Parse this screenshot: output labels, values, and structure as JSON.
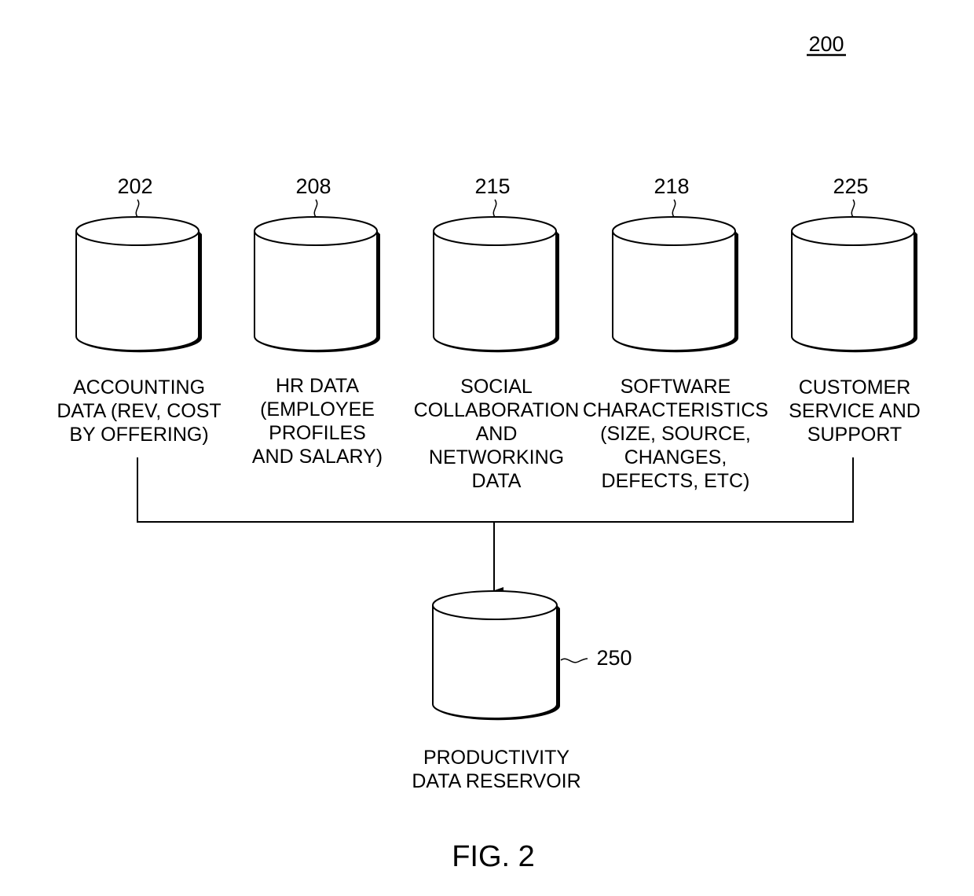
{
  "figure": {
    "number_label": "200",
    "caption": "FIG. 2"
  },
  "sources": [
    {
      "ref": "202",
      "lines": [
        "ACCOUNTING",
        "DATA (REV, COST",
        "BY OFFERING)"
      ]
    },
    {
      "ref": "208",
      "lines": [
        "HR DATA",
        "(EMPLOYEE",
        "PROFILES",
        "AND SALARY)"
      ]
    },
    {
      "ref": "215",
      "lines": [
        "SOCIAL",
        "COLLABORATION",
        "AND",
        "NETWORKING",
        "DATA"
      ]
    },
    {
      "ref": "218",
      "lines": [
        "SOFTWARE",
        "CHARACTERISTICS",
        "(SIZE, SOURCE,",
        "CHANGES,",
        "DEFECTS, ETC)"
      ]
    },
    {
      "ref": "225",
      "lines": [
        "CUSTOMER",
        "SERVICE AND",
        "SUPPORT"
      ]
    }
  ],
  "reservoir": {
    "ref": "250",
    "lines": [
      "PRODUCTIVITY",
      "DATA RESERVOIR"
    ]
  }
}
